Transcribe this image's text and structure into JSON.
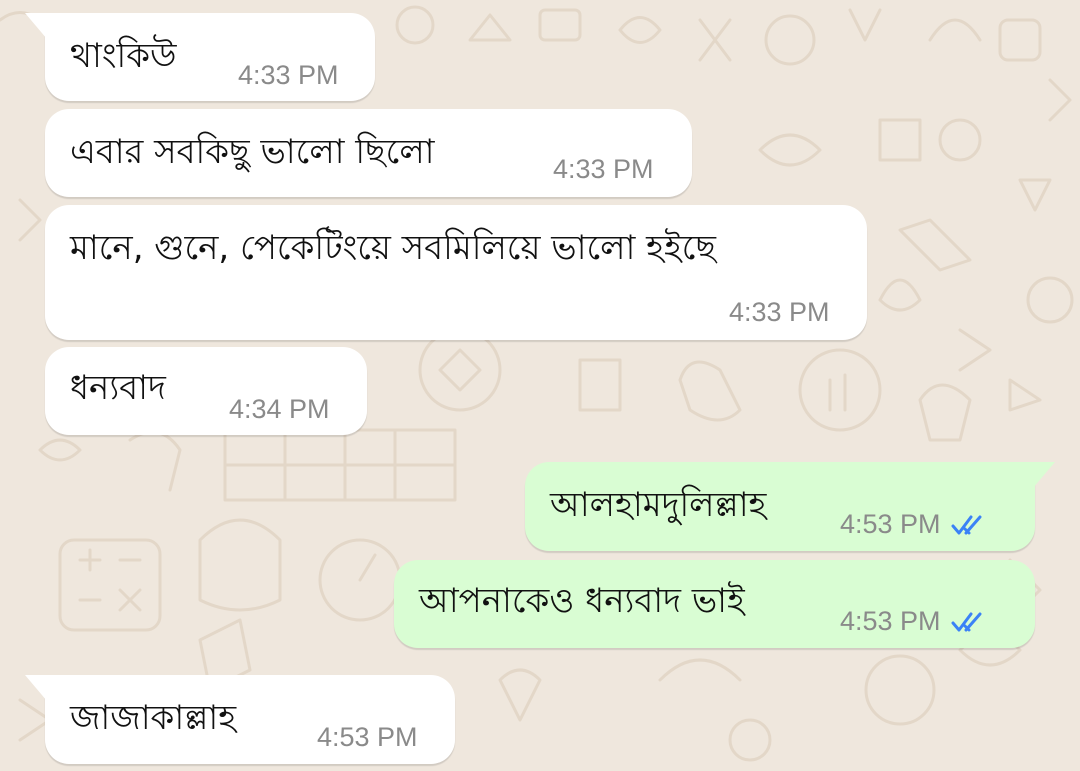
{
  "messages": [
    {
      "direction": "incoming",
      "text": "থাংকিউ",
      "time": "4:33 PM"
    },
    {
      "direction": "incoming",
      "text": "এবার সবকিছু ভালো ছিলো",
      "time": "4:33 PM"
    },
    {
      "direction": "incoming",
      "text": "মানে, গুনে, পেকেটিংয়ে সবমিলিয়ে ভালো হইছে",
      "time": "4:33 PM"
    },
    {
      "direction": "incoming",
      "text": "ধন্যবাদ",
      "time": "4:34 PM"
    },
    {
      "direction": "outgoing",
      "text": "আলহামদুলিল্লাহ",
      "time": "4:53 PM",
      "status": "read",
      "status_icon": "double-check-icon"
    },
    {
      "direction": "outgoing",
      "text": "আপনাকেও ধন্যবাদ ভাই",
      "time": "4:53 PM",
      "status": "read",
      "status_icon": "double-check-icon"
    },
    {
      "direction": "incoming",
      "text": "জাজাকাল্লাহ",
      "time": "4:53 PM"
    }
  ],
  "colors": {
    "wallpaper": "#efe7dd",
    "incoming_bubble": "#ffffff",
    "outgoing_bubble": "#d9fdd3",
    "timestamp": "#8a8a8a",
    "read_receipt": "#3b82f6"
  }
}
